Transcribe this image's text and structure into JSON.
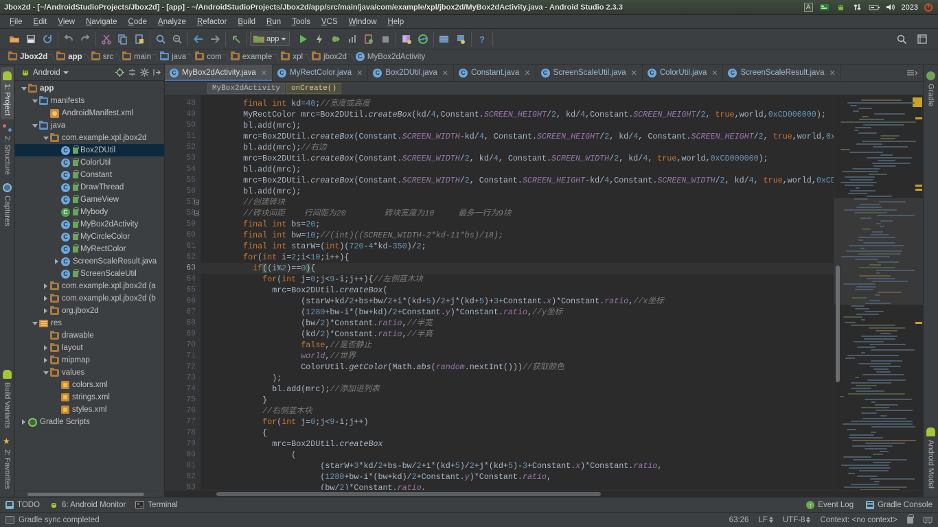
{
  "window": {
    "title": "Jbox2d - [~/AndroidStudioProjects/Jbox2d] - [app] - ~/AndroidStudioProjects/Jbox2d/app/src/main/java/com/example/xpl/jbox2d/MyBox2dActivity.java - Android Studio 2.3.3",
    "tray": {
      "keyboard": "A",
      "clock": "2023"
    }
  },
  "menubar": {
    "items": [
      "File",
      "Edit",
      "View",
      "Navigate",
      "Code",
      "Analyze",
      "Refactor",
      "Build",
      "Run",
      "Tools",
      "VCS",
      "Window",
      "Help"
    ]
  },
  "toolbar": {
    "run_config": "app",
    "icons": [
      "open-folder-icon",
      "save-all-icon",
      "sync-icon",
      "undo-icon",
      "redo-icon",
      "cut-icon",
      "copy-icon",
      "paste-icon",
      "find-icon",
      "replace-icon",
      "back-icon",
      "forward-icon",
      "jump-to-source-icon",
      "run-icon",
      "apply-changes-icon",
      "debug-icon",
      "profile-icon",
      "avd-manager-icon",
      "stop-icon",
      "sdk-manager-icon",
      "gradle-sync-icon",
      "project-structure-icon",
      "layout-inspector-icon",
      "help-icon",
      "search-everywhere-icon",
      "settings-icon"
    ]
  },
  "breadcrumb": {
    "items": [
      "Jbox2d",
      "app",
      "src",
      "main",
      "java",
      "com",
      "example",
      "xpl",
      "jbox2d",
      "MyBox2dActivity"
    ]
  },
  "left_strip": {
    "top": [
      "1: Project",
      "2: Structure",
      "Captures"
    ],
    "bottom": [
      "Build Variants",
      "2: Favorites"
    ]
  },
  "right_strip": {
    "top": [
      "Gradle"
    ],
    "bottom": [
      "Android Model"
    ]
  },
  "project_panel": {
    "view_selector": "Android",
    "tree": [
      {
        "label": "app",
        "depth": 0,
        "twisty": "open",
        "icon": "module-folder-icon",
        "bold": true,
        "selected": false
      },
      {
        "label": "manifests",
        "depth": 1,
        "twisty": "open",
        "icon": "folder-blue-icon",
        "bold": false,
        "selected": false
      },
      {
        "label": "AndroidManifest.xml",
        "depth": 2,
        "twisty": "none",
        "icon": "manifest-icon",
        "bold": false,
        "selected": false
      },
      {
        "label": "java",
        "depth": 1,
        "twisty": "open",
        "icon": "folder-blue-icon",
        "bold": false,
        "selected": false
      },
      {
        "label": "com.example.xpl.jbox2d",
        "depth": 2,
        "twisty": "open",
        "icon": "package-icon",
        "bold": false,
        "selected": false
      },
      {
        "label": "Box2DUtil",
        "depth": 3,
        "twisty": "none",
        "icon": "java-class-icon",
        "lock": true,
        "selected": true
      },
      {
        "label": "ColorUtil",
        "depth": 3,
        "twisty": "none",
        "icon": "java-class-icon",
        "lock": true,
        "selected": false
      },
      {
        "label": "Constant",
        "depth": 3,
        "twisty": "none",
        "icon": "java-class-icon",
        "lock": true,
        "selected": false
      },
      {
        "label": "DrawThread",
        "depth": 3,
        "twisty": "none",
        "icon": "java-class-icon",
        "lock": true,
        "selected": false
      },
      {
        "label": "GameView",
        "depth": 3,
        "twisty": "none",
        "icon": "java-class-icon",
        "lock": true,
        "selected": false
      },
      {
        "label": "Mybody",
        "depth": 3,
        "twisty": "none",
        "icon": "java-class-green-icon",
        "lock": true,
        "selected": false
      },
      {
        "label": "MyBox2dActivity",
        "depth": 3,
        "twisty": "none",
        "icon": "java-class-icon",
        "lock": true,
        "selected": false
      },
      {
        "label": "MyCircleColor",
        "depth": 3,
        "twisty": "none",
        "icon": "java-class-icon",
        "lock": true,
        "selected": false
      },
      {
        "label": "MyRectColor",
        "depth": 3,
        "twisty": "none",
        "icon": "java-class-icon",
        "lock": true,
        "selected": false
      },
      {
        "label": "ScreenScaleResult.java",
        "depth": 3,
        "twisty": "closed",
        "icon": "java-class-icon",
        "lock": false,
        "selected": false
      },
      {
        "label": "ScreenScaleUtil",
        "depth": 3,
        "twisty": "none",
        "icon": "java-class-icon",
        "lock": true,
        "selected": false
      },
      {
        "label": "com.example.xpl.jbox2d (a",
        "depth": 2,
        "twisty": "closed",
        "icon": "package-icon",
        "selected": false
      },
      {
        "label": "com.example.xpl.jbox2d (b",
        "depth": 2,
        "twisty": "closed",
        "icon": "package-icon",
        "selected": false
      },
      {
        "label": "org.jbox2d",
        "depth": 2,
        "twisty": "closed",
        "icon": "package-icon",
        "selected": false
      },
      {
        "label": "res",
        "depth": 1,
        "twisty": "open",
        "icon": "res-folder-icon",
        "selected": false
      },
      {
        "label": "drawable",
        "depth": 2,
        "twisty": "none",
        "icon": "package-icon",
        "selected": false
      },
      {
        "label": "layout",
        "depth": 2,
        "twisty": "closed",
        "icon": "package-icon",
        "selected": false
      },
      {
        "label": "mipmap",
        "depth": 2,
        "twisty": "closed",
        "icon": "package-icon",
        "selected": false
      },
      {
        "label": "values",
        "depth": 2,
        "twisty": "open",
        "icon": "package-icon",
        "selected": false
      },
      {
        "label": "colors.xml",
        "depth": 3,
        "twisty": "none",
        "icon": "xml-file-icon",
        "selected": false
      },
      {
        "label": "strings.xml",
        "depth": 3,
        "twisty": "none",
        "icon": "xml-file-icon",
        "selected": false
      },
      {
        "label": "styles.xml",
        "depth": 3,
        "twisty": "none",
        "icon": "xml-file-icon",
        "selected": false
      },
      {
        "label": "Gradle Scripts",
        "depth": 0,
        "twisty": "closed",
        "icon": "gradle-icon",
        "selected": false
      }
    ]
  },
  "editor": {
    "tabs": [
      {
        "label": "MyBox2dActivity.java",
        "active": true
      },
      {
        "label": "MyRectColor.java",
        "active": false
      },
      {
        "label": "Box2DUtil.java",
        "active": false
      },
      {
        "label": "Constant.java",
        "active": false
      },
      {
        "label": "ScreenScaleUtil.java",
        "active": false
      },
      {
        "label": "ColorUtil.java",
        "active": false
      },
      {
        "label": "ScreenScaleResult.java",
        "active": false
      }
    ],
    "structure_breadcrumb": [
      "MyBox2dActivity",
      "onCreate()"
    ],
    "first_line_number": 48,
    "lines": [
      {
        "n": 48,
        "indent": 8,
        "html": "<span class='kw'>final</span> <span class='kw'>int</span> kd=<span class='num'>40</span>;<span class='cmtz'>//宽度或高度</span>"
      },
      {
        "n": 49,
        "indent": 8,
        "html": "MyRectColor mrc=Box2DUtil.<span class='mth'>createBox</span>(kd/<span class='num'>4</span>,Constant.<span class='sfld'>SCREEN_HEIGHT</span>/<span class='num'>2</span>, kd/<span class='num'>4</span>,Constant.<span class='sfld'>SCREEN_HEIGHT</span>/<span class='num'>2</span>, <span class='kw'>true</span>,world,<span class='num'>0xCD000000</span>);"
      },
      {
        "n": 50,
        "indent": 8,
        "html": "bl.add(mrc);"
      },
      {
        "n": 51,
        "indent": 8,
        "html": "mrc=Box2DUtil.<span class='mth'>createBox</span>(Constant.<span class='sfld'>SCREEN_WIDTH</span>-kd/<span class='num'>4</span>, Constant.<span class='sfld'>SCREEN_HEIGHT</span>/<span class='num'>2</span>, kd/<span class='num'>4</span>, Constant.<span class='sfld'>SCREEN_HEIGHT</span>/<span class='num'>2</span>, <span class='kw'>true</span>,world,<span class='num'>0x</span>"
      },
      {
        "n": 52,
        "indent": 8,
        "html": "bl.add(mrc);<span class='cmtz'>//右边</span>"
      },
      {
        "n": 53,
        "indent": 8,
        "html": "mrc=Box2DUtil.<span class='mth'>createBox</span>(Constant.<span class='sfld'>SCREEN_WIDTH</span>/<span class='num'>2</span>, kd/<span class='num'>4</span>, Constant.<span class='sfld'>SCREEN_WIDTH</span>/<span class='num'>2</span>, kd/<span class='num'>4</span>, <span class='kw'>true</span>,world,<span class='num'>0xCD000000</span>);"
      },
      {
        "n": 54,
        "indent": 8,
        "html": "bl.add(mrc);"
      },
      {
        "n": 55,
        "indent": 8,
        "html": "mrc=Box2DUtil.<span class='mth'>createBox</span>(Constant.<span class='sfld'>SCREEN_WIDTH</span>/<span class='num'>2</span>, Constant.<span class='sfld'>SCREEN_HEIGHT</span>-kd/<span class='num'>4</span>,Constant.<span class='sfld'>SCREEN_WIDTH</span>/<span class='num'>2</span>, kd/<span class='num'>4</span>, <span class='kw'>true</span>,world,<span class='num'>0xCD0</span>"
      },
      {
        "n": 56,
        "indent": 8,
        "html": "bl.add(mrc);"
      },
      {
        "n": 57,
        "indent": 8,
        "html": "<span class='cmtz'>//创建砖块</span>"
      },
      {
        "n": 58,
        "indent": 8,
        "html": "<span class='cmtz'>//砖块间距    行间距为20        砖块宽度为10     最多一行为9块</span>"
      },
      {
        "n": 59,
        "indent": 8,
        "html": "<span class='kw'>final</span> <span class='kw'>int</span> bs=<span class='num'>20</span>;"
      },
      {
        "n": 60,
        "indent": 8,
        "html": "<span class='kw'>final</span> <span class='kw'>int</span> bw=<span class='num'>10</span>;<span class='cmt'>//(int)((SCREEN_WIDTH-2*kd-11*bs)/18);</span>"
      },
      {
        "n": 61,
        "indent": 8,
        "html": "<span class='kw'>final</span> <span class='kw'>int</span> starW=(<span class='kw'>int</span>)(<span class='num'>720</span>-<span class='num'>4</span>*kd-<span class='num'>350</span>)/<span class='num'>2</span>;"
      },
      {
        "n": 62,
        "indent": 8,
        "html": "<span class='kw'>for</span>(<span class='kw'>int</span> i=<span class='num'>2</span>;i&lt;<span class='num'>10</span>;i++){"
      },
      {
        "n": 63,
        "indent": 10,
        "html": "<span class='kw'>if</span><span class='hlbr'>(</span>(i%<span class='num'>2</span>)==<span class='num'>0</span><span class='hlbr'>)</span>{",
        "current": true
      },
      {
        "n": 64,
        "indent": 12,
        "html": "<span class='kw'>for</span>(<span class='kw'>int</span> j=<span class='num'>0</span>;j&lt;<span class='num'>9</span>-i;j++){<span class='cmtz'>//左侧蓝木块</span>"
      },
      {
        "n": 65,
        "indent": 14,
        "html": "mrc=Box2DUtil.<span class='mth'>createBox</span>("
      },
      {
        "n": 66,
        "indent": 20,
        "html": "(starW+kd/<span class='num'>2</span>+bs+bw/<span class='num'>2</span>+i*(kd+<span class='num'>5</span>)/<span class='num'>2</span>+j*(kd+<span class='num'>5</span>)+<span class='num'>3</span>+Constant.<span class='fld'>x</span>)*Constant.<span class='fld'>ratio</span>,<span class='cmtz'>//x坐标</span>"
      },
      {
        "n": 67,
        "indent": 20,
        "html": "(<span class='num'>1280</span>+bw-i*(bw+kd)/<span class='num'>2</span>+Constant.<span class='fld'>y</span>)*Constant.<span class='fld'>ratio</span>,<span class='cmtz'>//y坐标</span>"
      },
      {
        "n": 68,
        "indent": 20,
        "html": "(bw/<span class='num'>2</span>)*Constant.<span class='fld'>ratio</span>,<span class='cmtz'>//半宽</span>"
      },
      {
        "n": 69,
        "indent": 20,
        "html": "(kd/<span class='num'>2</span>)*Constant.<span class='fld'>ratio</span>,<span class='cmtz'>//半高</span>"
      },
      {
        "n": 70,
        "indent": 20,
        "html": "<span class='kw'>false</span>,<span class='cmtz'>//是否静止</span>"
      },
      {
        "n": 71,
        "indent": 20,
        "html": "<span class='fld'>world</span>,<span class='cmtz'>//世界</span>"
      },
      {
        "n": 72,
        "indent": 20,
        "html": "ColorUtil.<span class='mth'>getColor</span>(Math.<span class='mth'>abs</span>(<span class='fld'>random</span>.nextInt()))<span class='cmtz'>//获取颜色</span>"
      },
      {
        "n": 73,
        "indent": 14,
        "html": ");"
      },
      {
        "n": 74,
        "indent": 14,
        "html": "bl.add(mrc);<span class='cmtz'>//添加进列表</span>"
      },
      {
        "n": 75,
        "indent": 12,
        "html": "}"
      },
      {
        "n": 76,
        "indent": 12,
        "html": "<span class='cmtz'>//右侧蓝木块</span>"
      },
      {
        "n": 77,
        "indent": 12,
        "html": "<span class='kw'>for</span>(<span class='kw'>int</span> j=<span class='num'>0</span>;j&lt;<span class='num'>9</span>-i;j++)"
      },
      {
        "n": 78,
        "indent": 12,
        "html": "{"
      },
      {
        "n": 79,
        "indent": 14,
        "html": "mrc=Box2DUtil.<span class='mth'>createBox</span>"
      },
      {
        "n": 80,
        "indent": 18,
        "html": "("
      },
      {
        "n": 81,
        "indent": 24,
        "html": "(starW+<span class='num'>3</span>*kd/<span class='num'>2</span>+bs-bw/<span class='num'>2</span>+i*(kd+<span class='num'>5</span>)/<span class='num'>2</span>+j*(kd+<span class='num'>5</span>)-<span class='num'>3</span>+Constant.<span class='fld'>x</span>)*Constant.<span class='fld'>ratio</span>,"
      },
      {
        "n": 82,
        "indent": 24,
        "html": "(<span class='num'>1280</span>+bw-i*(bw+kd)/<span class='num'>2</span>+Constant.<span class='fld'>y</span>)*Constant.<span class='fld'>ratio</span>,"
      },
      {
        "n": 83,
        "indent": 24,
        "html": "(bw/<span class='num'>2</span>)*Constant.<span class='fld'>ratio</span>,"
      }
    ]
  },
  "bottom_bar": {
    "tabs": [
      {
        "label": "TODO",
        "icon": "todo-icon"
      },
      {
        "label": "6: Android Monitor",
        "icon": "android-icon"
      },
      {
        "label": "Terminal",
        "icon": "terminal-icon"
      }
    ],
    "right": [
      {
        "label": "Event Log",
        "icon": "event-log-icon"
      },
      {
        "label": "Gradle Console",
        "icon": "gradle-console-icon"
      }
    ]
  },
  "status_bar": {
    "message": "Gradle sync completed",
    "caret": "63:26",
    "line_separator": "LF",
    "encoding": "UTF-8",
    "context": "Context: <no context>"
  }
}
